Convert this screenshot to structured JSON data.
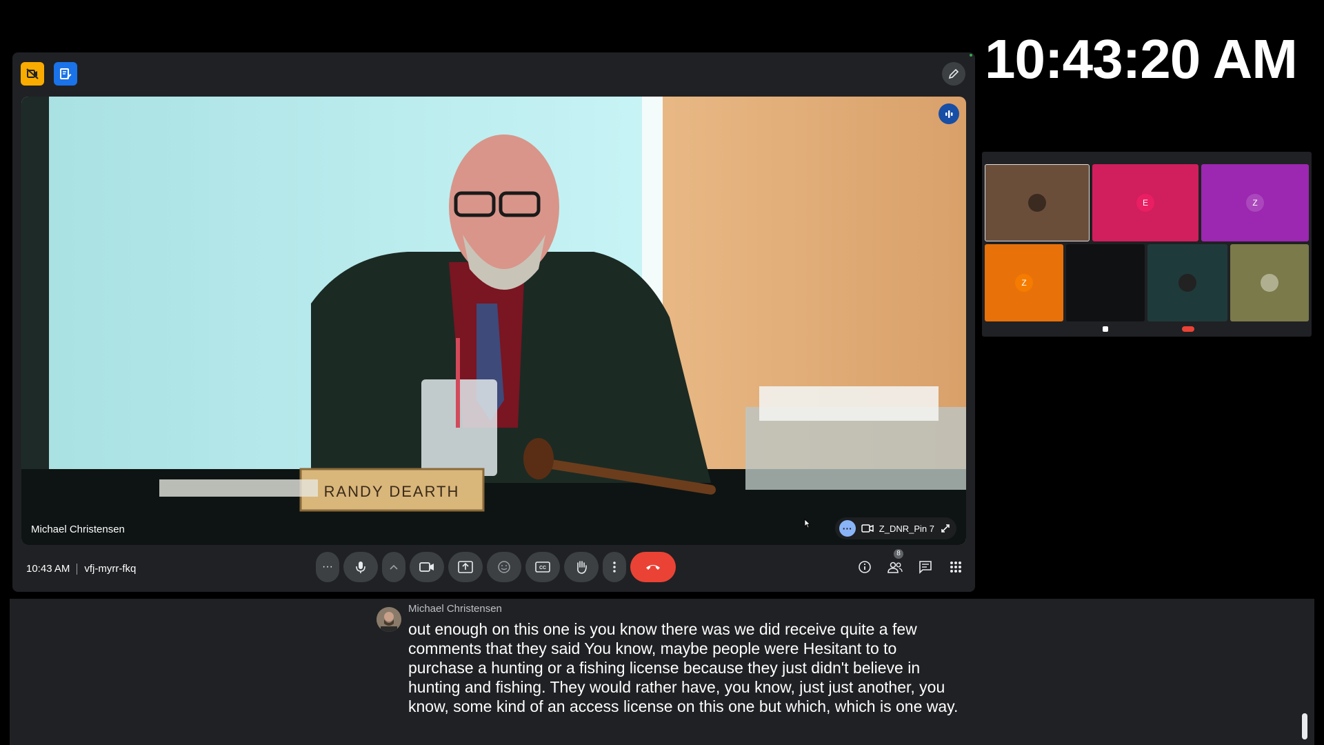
{
  "clock": {
    "time": "10:43:20 AM"
  },
  "meeting": {
    "time": "10:43 AM",
    "code": "vfj-myrr-fkq",
    "active_speaker": "Michael Christensen",
    "pinned_tile": "Z_DNR_Pin 7",
    "participant_count": "8",
    "nameplate": "RANDY DEARTH"
  },
  "thumbnail": {
    "tiles": [
      {
        "initial": "",
        "color": "#6b4e3a"
      },
      {
        "initial": "E",
        "color": "#d11e5c"
      },
      {
        "initial": "Z",
        "color": "#9c27b0"
      },
      {
        "initial": "Z",
        "color": "#e8710a"
      },
      {
        "initial": "",
        "color": "#101113"
      },
      {
        "initial": "",
        "color": "#1f3a3a"
      },
      {
        "initial": "",
        "color": "#7a7a4a"
      }
    ]
  },
  "captions": {
    "speaker": "Michael Christensen",
    "text": "out enough on this one is you know there was we did receive quite a few comments that they said You know, maybe people were Hesitant to to purchase a hunting or a fishing license because they just didn't believe in hunting and fishing. They would rather have, you know, just just another, you know, some kind of an access license on this one but which, which is one way."
  },
  "colors": {
    "meet_bg": "#202124",
    "end_call": "#ea4335",
    "accent_blue": "#1a73e8",
    "accent_yellow": "#f9ab00"
  },
  "icons": [
    "camera-off-icon",
    "note-edit-icon",
    "pencil-icon",
    "speaking-icon",
    "more-dots-icon",
    "microphone-icon",
    "chevron-up-icon",
    "video-camera-icon",
    "present-icon",
    "emoji-icon",
    "captions-icon",
    "raise-hand-icon",
    "more-vert-icon",
    "end-call-icon",
    "info-icon",
    "people-icon",
    "chat-icon",
    "activities-icon",
    "expand-icon"
  ]
}
